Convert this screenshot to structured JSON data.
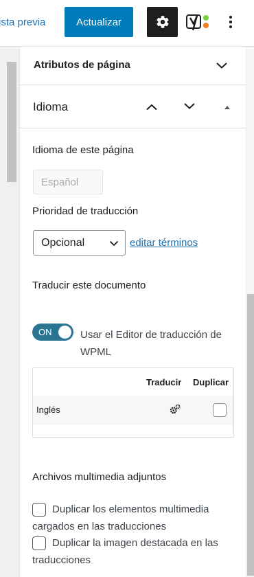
{
  "toolbar": {
    "preview_label": "ista previa",
    "update_label": "Actualizar",
    "settings_icon": "gear-icon",
    "yoast_icon": "yoast-logo-icon",
    "more_icon": "vertical-ellipsis-icon"
  },
  "panels": {
    "page_attributes": {
      "title": "Atributos de página",
      "icon": "chevron-down-icon"
    },
    "language": {
      "title": "Idioma",
      "icons": [
        "chevron-up-icon",
        "chevron-down-icon",
        "caret-up-icon"
      ]
    }
  },
  "language_section": {
    "page_language_label": "Idioma de este página",
    "page_language_value": "Español",
    "priority_label": "Prioridad de traducción",
    "priority_value": "Opcional",
    "edit_terms_link": "editar términos",
    "translate_doc_label": "Traducir este documento",
    "toggle_state": "ON",
    "toggle_label": "Usar el Editor de traducción de WPML"
  },
  "translation_table": {
    "headers": [
      "Traducir",
      "Duplicar"
    ],
    "rows": [
      {
        "language": "Inglés",
        "translate_icon": "gears-icon",
        "duplicate_checked": false
      }
    ]
  },
  "media_section": {
    "label": "Archivos multimedia adjuntos",
    "options": [
      {
        "label": "Duplicar los elementos multimedia cargados en las traducciones",
        "checked": false
      },
      {
        "label": "Duplicar la imagen destacada en las traducciones",
        "checked": false
      }
    ]
  },
  "colors": {
    "accent": "#007cba",
    "link": "#2271b1",
    "toggle_on": "#2c7592",
    "dark_button": "#1e1e1e"
  }
}
